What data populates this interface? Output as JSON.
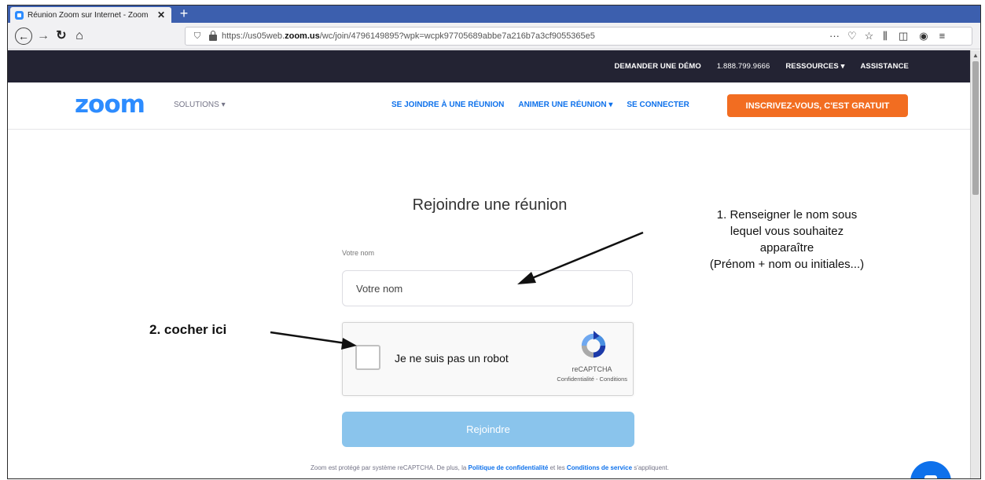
{
  "browser": {
    "tab_title": "Réunion Zoom sur Internet - Zoom",
    "tab_close": "✕",
    "new_tab": "+",
    "url_prefix": "https://us05web.",
    "url_domain": "zoom.us",
    "url_path": "/wc/join/4796149895?wpk=wcpk97705689abbe7a216b7a3cf9055365e5",
    "page_actions": "···"
  },
  "topbar": {
    "demo": "DEMANDER UNE DÉMO",
    "phone": "1.888.799.9666",
    "resources": "RESSOURCES ▾",
    "assistance": "ASSISTANCE"
  },
  "nav": {
    "logo": "zoom",
    "solutions": "SOLUTIONS ▾",
    "join": "SE JOINDRE À UNE RÉUNION",
    "host": "ANIMER UNE RÉUNION ▾",
    "signin": "SE CONNECTER",
    "signup": "INSCRIVEZ-VOUS, C'EST GRATUIT"
  },
  "form": {
    "title": "Rejoindre une réunion",
    "name_label": "Votre nom",
    "name_placeholder": "Votre nom",
    "captcha_label": "Je ne suis pas un robot",
    "captcha_brand": "reCAPTCHA",
    "captcha_links": "Confidentialité - Conditions",
    "join_button": "Rejoindre"
  },
  "footer": {
    "prefix": "Zoom est protégé par système reCAPTCHA. De plus, la ",
    "privacy": "Politique de confidentialité",
    "middle": " et les ",
    "terms": "Conditions de service",
    "suffix": " s'appliquent."
  },
  "annotations": {
    "step1_line1": "1. Renseigner le nom sous",
    "step1_line2": "lequel vous souhaitez",
    "step1_line3": "apparaître",
    "step1_line4": "(Prénom + nom ou initiales...)",
    "step2": "2. cocher ici"
  },
  "colors": {
    "brand_blue": "#2d8cff",
    "cta_orange": "#f26d21",
    "topbar_dark": "#232333",
    "link_blue": "#0e71eb",
    "join_disabled": "#8ac4ec"
  },
  "icons": [
    "back-icon",
    "forward-icon",
    "reload-icon",
    "home-icon",
    "shield-icon",
    "lock-icon",
    "pocket-icon",
    "bookmark-star-icon",
    "library-icon",
    "sidebar-icon",
    "account-icon",
    "menu-icon",
    "recaptcha-icon",
    "chat-icon"
  ]
}
